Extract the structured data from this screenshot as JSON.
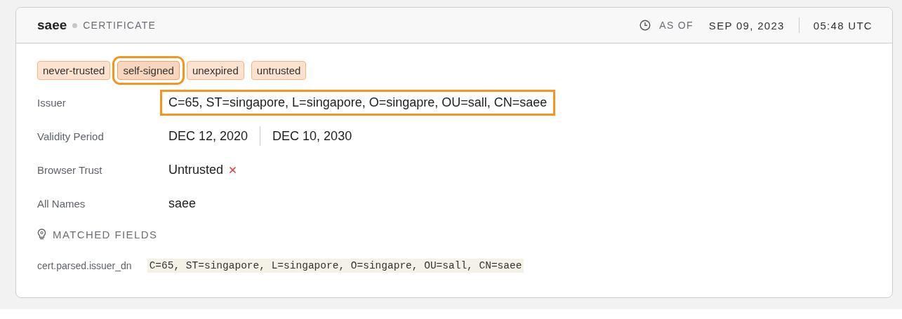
{
  "header": {
    "name": "saee",
    "type": "CERTIFICATE",
    "as_of_label": "AS OF",
    "date": "SEP 09, 2023",
    "time": "05:48 UTC"
  },
  "tags": [
    {
      "label": "never-trusted",
      "highlighted": false
    },
    {
      "label": "self-signed",
      "highlighted": true
    },
    {
      "label": "unexpired",
      "highlighted": false
    },
    {
      "label": "untrusted",
      "highlighted": false
    }
  ],
  "fields": [
    {
      "kind": "text",
      "label": "Issuer",
      "value": "C=65, ST=singapore, L=singapore, O=singapre, OU=sall, CN=saee",
      "highlighted": true
    },
    {
      "kind": "period",
      "label": "Validity Period",
      "start": "DEC 12, 2020",
      "end": "DEC 10, 2030"
    },
    {
      "kind": "trust",
      "label": "Browser Trust",
      "value": "Untrusted",
      "trusted": false
    },
    {
      "kind": "text",
      "label": "All Names",
      "value": "saee",
      "highlighted": false
    }
  ],
  "matched_fields": {
    "title": "MATCHED FIELDS",
    "items": [
      {
        "field": "cert.parsed.issuer_dn",
        "value": "C=65, ST=singapore, L=singapore, O=singapre, OU=sall, CN=saee"
      }
    ]
  }
}
